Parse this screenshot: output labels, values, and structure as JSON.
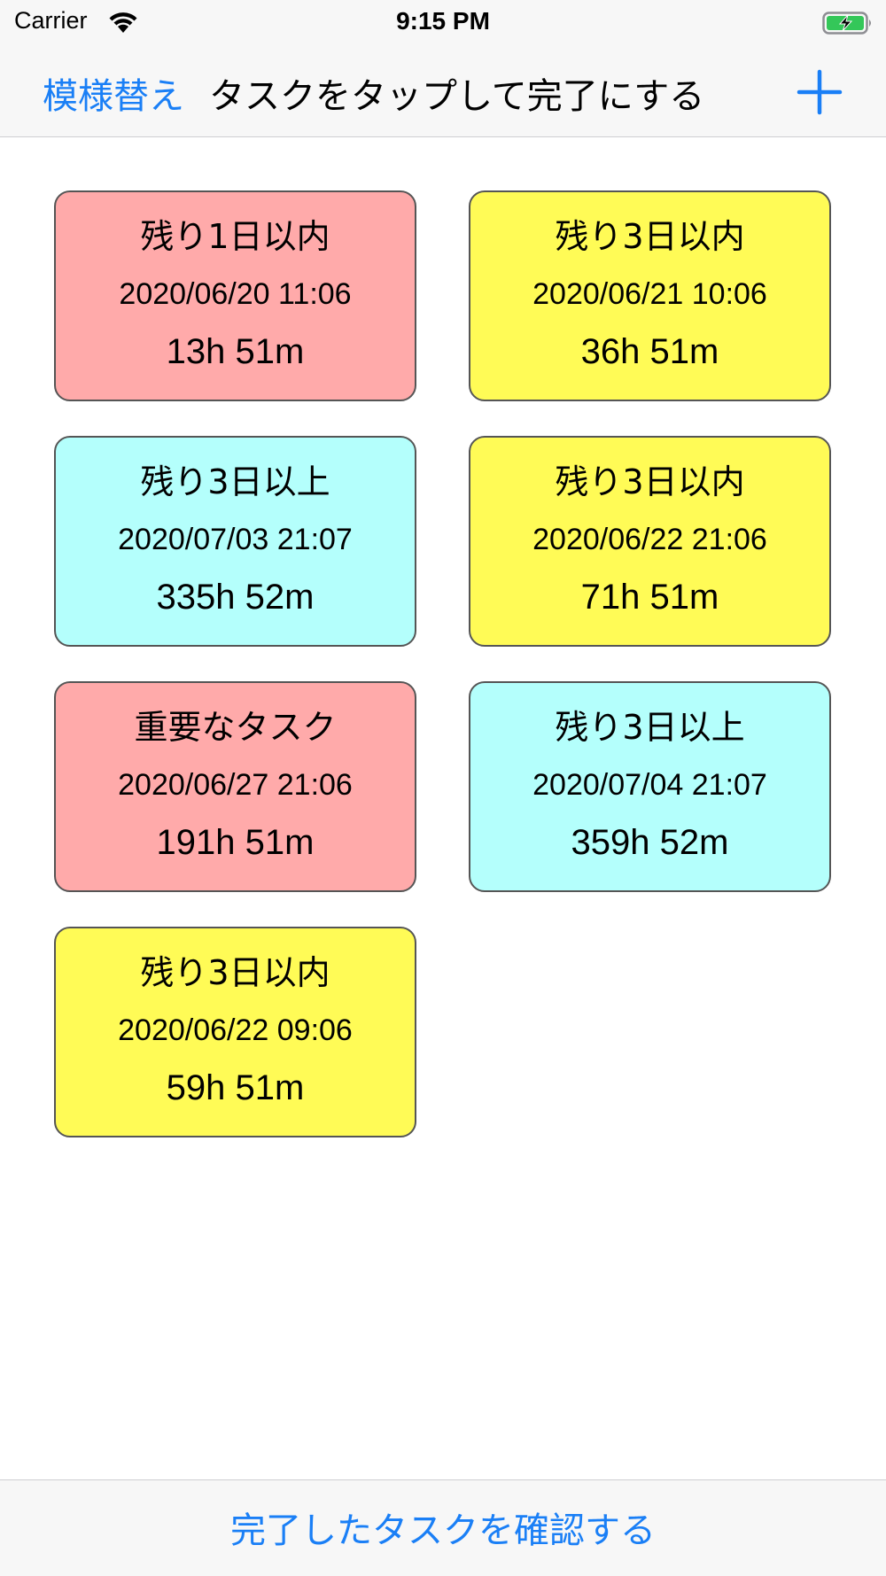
{
  "status_bar": {
    "carrier": "Carrier",
    "time": "9:15 PM",
    "wifi_icon": "wifi-icon",
    "battery_icon": "battery-charging-icon",
    "battery_color": "#34c759"
  },
  "nav": {
    "left_button": "模様替え",
    "title": "タスクをタップして完了にする",
    "add_icon": "plus-icon",
    "accent": "#1a7ff6"
  },
  "tasks": [
    {
      "title": "残り1日以内",
      "date": "2020/06/20 11:06",
      "remaining": "13h 51m",
      "color": "#ffaaaa"
    },
    {
      "title": "残り3日以内",
      "date": "2020/06/21 10:06",
      "remaining": "36h 51m",
      "color": "#fffb56"
    },
    {
      "title": "残り3日以上",
      "date": "2020/07/03 21:07",
      "remaining": "335h 52m",
      "color": "#b4fffc"
    },
    {
      "title": "残り3日以内",
      "date": "2020/06/22 21:06",
      "remaining": "71h 51m",
      "color": "#fffb56"
    },
    {
      "title": "重要なタスク",
      "date": "2020/06/27 21:06",
      "remaining": "191h 51m",
      "color": "#ffaaaa"
    },
    {
      "title": "残り3日以上",
      "date": "2020/07/04 21:07",
      "remaining": "359h 52m",
      "color": "#b4fffc"
    },
    {
      "title": "残り3日以内",
      "date": "2020/06/22 09:06",
      "remaining": "59h 51m",
      "color": "#fffb56"
    }
  ],
  "toolbar": {
    "button_label": "完了したタスクを確認する"
  }
}
